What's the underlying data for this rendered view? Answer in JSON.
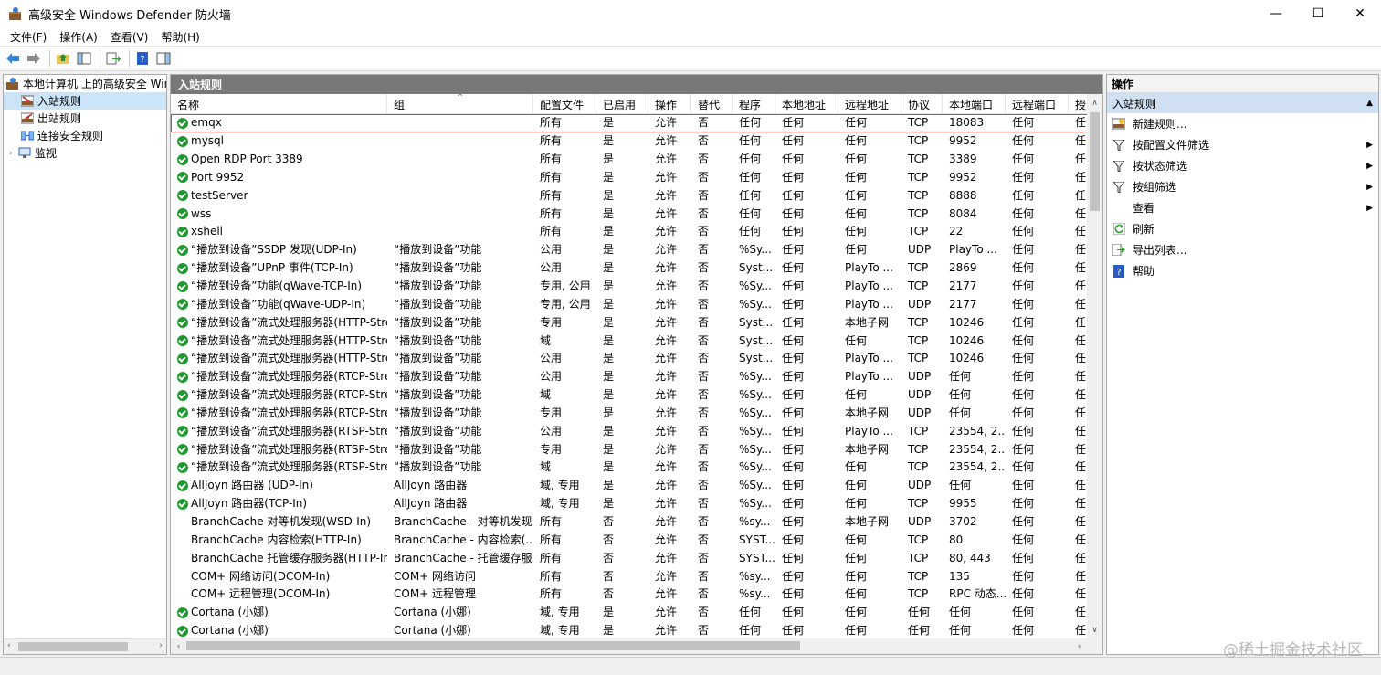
{
  "window": {
    "title": "高级安全 Windows Defender 防火墙",
    "controls": [
      "—",
      "☐",
      "✕"
    ]
  },
  "menu": [
    "文件(F)",
    "操作(A)",
    "查看(V)",
    "帮助(H)"
  ],
  "tree": {
    "items": [
      {
        "label": "本地计算机 上的高级安全 Windows",
        "level": 0
      },
      {
        "label": "入站规则",
        "level": 1
      },
      {
        "label": "出站规则",
        "level": 1
      },
      {
        "label": "连接安全规则",
        "level": 1
      },
      {
        "label": "监视",
        "level": 0
      }
    ]
  },
  "center": {
    "title": "入站规则",
    "columns": [
      "名称",
      "组",
      "配置文件",
      "已启用",
      "操作",
      "替代",
      "程序",
      "本地地址",
      "远程地址",
      "协议",
      "本地端口",
      "远程端口",
      "授"
    ],
    "rows": [
      {
        "enabled": true,
        "cells": [
          "emqx",
          "",
          "所有",
          "是",
          "允许",
          "否",
          "任何",
          "任何",
          "任何",
          "TCP",
          "18083",
          "任何",
          "任"
        ]
      },
      {
        "enabled": true,
        "cells": [
          "mysql",
          "",
          "所有",
          "是",
          "允许",
          "否",
          "任何",
          "任何",
          "任何",
          "TCP",
          "9952",
          "任何",
          "任"
        ]
      },
      {
        "enabled": true,
        "cells": [
          "Open RDP Port 3389",
          "",
          "所有",
          "是",
          "允许",
          "否",
          "任何",
          "任何",
          "任何",
          "TCP",
          "3389",
          "任何",
          "任"
        ]
      },
      {
        "enabled": true,
        "cells": [
          "Port 9952",
          "",
          "所有",
          "是",
          "允许",
          "否",
          "任何",
          "任何",
          "任何",
          "TCP",
          "9952",
          "任何",
          "任"
        ]
      },
      {
        "enabled": true,
        "cells": [
          "testServer",
          "",
          "所有",
          "是",
          "允许",
          "否",
          "任何",
          "任何",
          "任何",
          "TCP",
          "8888",
          "任何",
          "任"
        ]
      },
      {
        "enabled": true,
        "cells": [
          "wss",
          "",
          "所有",
          "是",
          "允许",
          "否",
          "任何",
          "任何",
          "任何",
          "TCP",
          "8084",
          "任何",
          "任"
        ]
      },
      {
        "enabled": true,
        "cells": [
          "xshell",
          "",
          "所有",
          "是",
          "允许",
          "否",
          "任何",
          "任何",
          "任何",
          "TCP",
          "22",
          "任何",
          "任"
        ]
      },
      {
        "enabled": true,
        "cells": [
          "“播放到设备”SSDP 发现(UDP-In)",
          "“播放到设备”功能",
          "公用",
          "是",
          "允许",
          "否",
          "%Sy...",
          "任何",
          "任何",
          "UDP",
          "PlayTo ...",
          "任何",
          "任"
        ]
      },
      {
        "enabled": true,
        "cells": [
          "“播放到设备”UPnP 事件(TCP-In)",
          "“播放到设备”功能",
          "公用",
          "是",
          "允许",
          "否",
          "Syst...",
          "任何",
          "PlayTo ...",
          "TCP",
          "2869",
          "任何",
          "任"
        ]
      },
      {
        "enabled": true,
        "cells": [
          "“播放到设备”功能(qWave-TCP-In)",
          "“播放到设备”功能",
          "专用, 公用",
          "是",
          "允许",
          "否",
          "%Sy...",
          "任何",
          "PlayTo ...",
          "TCP",
          "2177",
          "任何",
          "任"
        ]
      },
      {
        "enabled": true,
        "cells": [
          "“播放到设备”功能(qWave-UDP-In)",
          "“播放到设备”功能",
          "专用, 公用",
          "是",
          "允许",
          "否",
          "%Sy...",
          "任何",
          "PlayTo ...",
          "UDP",
          "2177",
          "任何",
          "任"
        ]
      },
      {
        "enabled": true,
        "cells": [
          "“播放到设备”流式处理服务器(HTTP-Stre...",
          "“播放到设备”功能",
          "专用",
          "是",
          "允许",
          "否",
          "Syst...",
          "任何",
          "本地子网",
          "TCP",
          "10246",
          "任何",
          "任"
        ]
      },
      {
        "enabled": true,
        "cells": [
          "“播放到设备”流式处理服务器(HTTP-Stre...",
          "“播放到设备”功能",
          "域",
          "是",
          "允许",
          "否",
          "Syst...",
          "任何",
          "任何",
          "TCP",
          "10246",
          "任何",
          "任"
        ]
      },
      {
        "enabled": true,
        "cells": [
          "“播放到设备”流式处理服务器(HTTP-Stre...",
          "“播放到设备”功能",
          "公用",
          "是",
          "允许",
          "否",
          "Syst...",
          "任何",
          "PlayTo ...",
          "TCP",
          "10246",
          "任何",
          "任"
        ]
      },
      {
        "enabled": true,
        "cells": [
          "“播放到设备”流式处理服务器(RTCP-Stre...",
          "“播放到设备”功能",
          "公用",
          "是",
          "允许",
          "否",
          "%Sy...",
          "任何",
          "PlayTo ...",
          "UDP",
          "任何",
          "任何",
          "任"
        ]
      },
      {
        "enabled": true,
        "cells": [
          "“播放到设备”流式处理服务器(RTCP-Stre...",
          "“播放到设备”功能",
          "域",
          "是",
          "允许",
          "否",
          "%Sy...",
          "任何",
          "任何",
          "UDP",
          "任何",
          "任何",
          "任"
        ]
      },
      {
        "enabled": true,
        "cells": [
          "“播放到设备”流式处理服务器(RTCP-Stre...",
          "“播放到设备”功能",
          "专用",
          "是",
          "允许",
          "否",
          "%Sy...",
          "任何",
          "本地子网",
          "UDP",
          "任何",
          "任何",
          "任"
        ]
      },
      {
        "enabled": true,
        "cells": [
          "“播放到设备”流式处理服务器(RTSP-Stre...",
          "“播放到设备”功能",
          "公用",
          "是",
          "允许",
          "否",
          "%Sy...",
          "任何",
          "PlayTo ...",
          "TCP",
          "23554, 2...",
          "任何",
          "任"
        ]
      },
      {
        "enabled": true,
        "cells": [
          "“播放到设备”流式处理服务器(RTSP-Stre...",
          "“播放到设备”功能",
          "专用",
          "是",
          "允许",
          "否",
          "%Sy...",
          "任何",
          "本地子网",
          "TCP",
          "23554, 2...",
          "任何",
          "任"
        ]
      },
      {
        "enabled": true,
        "cells": [
          "“播放到设备”流式处理服务器(RTSP-Stre...",
          "“播放到设备”功能",
          "域",
          "是",
          "允许",
          "否",
          "%Sy...",
          "任何",
          "任何",
          "TCP",
          "23554, 2...",
          "任何",
          "任"
        ]
      },
      {
        "enabled": true,
        "cells": [
          "AllJoyn 路由器 (UDP-In)",
          "AllJoyn 路由器",
          "域, 专用",
          "是",
          "允许",
          "否",
          "%Sy...",
          "任何",
          "任何",
          "UDP",
          "任何",
          "任何",
          "任"
        ]
      },
      {
        "enabled": true,
        "cells": [
          "AllJoyn 路由器(TCP-In)",
          "AllJoyn 路由器",
          "域, 专用",
          "是",
          "允许",
          "否",
          "%Sy...",
          "任何",
          "任何",
          "TCP",
          "9955",
          "任何",
          "任"
        ]
      },
      {
        "enabled": false,
        "cells": [
          "BranchCache 对等机发现(WSD-In)",
          "BranchCache - 对等机发现...",
          "所有",
          "否",
          "允许",
          "否",
          "%sy...",
          "任何",
          "本地子网",
          "UDP",
          "3702",
          "任何",
          "任"
        ]
      },
      {
        "enabled": false,
        "cells": [
          "BranchCache 内容检索(HTTP-In)",
          "BranchCache - 内容检索(...",
          "所有",
          "否",
          "允许",
          "否",
          "SYST...",
          "任何",
          "任何",
          "TCP",
          "80",
          "任何",
          "任"
        ]
      },
      {
        "enabled": false,
        "cells": [
          "BranchCache 托管缓存服务器(HTTP-In)",
          "BranchCache - 托管缓存服...",
          "所有",
          "否",
          "允许",
          "否",
          "SYST...",
          "任何",
          "任何",
          "TCP",
          "80, 443",
          "任何",
          "任"
        ]
      },
      {
        "enabled": false,
        "cells": [
          "COM+ 网络访问(DCOM-In)",
          "COM+ 网络访问",
          "所有",
          "否",
          "允许",
          "否",
          "%sy...",
          "任何",
          "任何",
          "TCP",
          "135",
          "任何",
          "任"
        ]
      },
      {
        "enabled": false,
        "cells": [
          "COM+ 远程管理(DCOM-In)",
          "COM+ 远程管理",
          "所有",
          "否",
          "允许",
          "否",
          "%sy...",
          "任何",
          "任何",
          "TCP",
          "RPC 动态...",
          "任何",
          "任"
        ]
      },
      {
        "enabled": true,
        "cells": [
          "Cortana (小娜)",
          "Cortana (小娜)",
          "域, 专用",
          "是",
          "允许",
          "否",
          "任何",
          "任何",
          "任何",
          "任何",
          "任何",
          "任何",
          "任"
        ]
      },
      {
        "enabled": true,
        "cells": [
          "Cortana (小娜)",
          "Cortana (小娜)",
          "域, 专用",
          "是",
          "允许",
          "否",
          "任何",
          "任何",
          "任何",
          "任何",
          "任何",
          "任何",
          "任"
        ]
      }
    ]
  },
  "actions": {
    "title": "操作",
    "section": "入站规则",
    "items": [
      {
        "label": "新建规则...",
        "icon": "new-rule-icon",
        "submenu": false
      },
      {
        "label": "按配置文件筛选",
        "icon": "filter-icon",
        "submenu": true
      },
      {
        "label": "按状态筛选",
        "icon": "filter-icon",
        "submenu": true
      },
      {
        "label": "按组筛选",
        "icon": "filter-icon",
        "submenu": true
      },
      {
        "label": "查看",
        "icon": "",
        "submenu": true
      },
      {
        "label": "刷新",
        "icon": "refresh-icon",
        "submenu": false
      },
      {
        "label": "导出列表...",
        "icon": "export-icon",
        "submenu": false
      },
      {
        "label": "帮助",
        "icon": "help-icon",
        "submenu": false
      }
    ]
  },
  "watermark": "@稀土掘金技术社区",
  "colors": {
    "accent": "#cfe0f2",
    "header_bar": "#787878",
    "enabled_check": "#1d9a2e",
    "selected_outline": "#e04040"
  }
}
